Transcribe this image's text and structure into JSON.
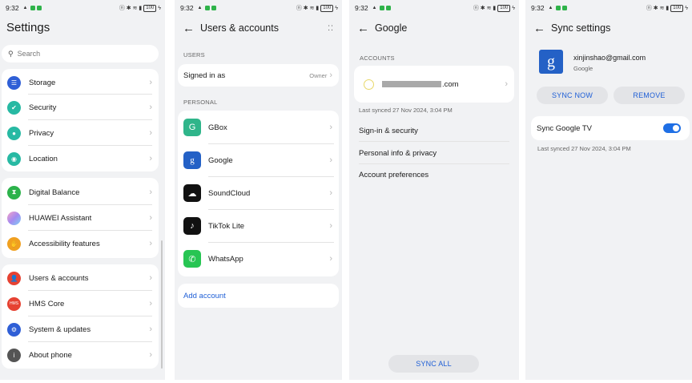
{
  "status": {
    "time": "9:32",
    "battery": "100"
  },
  "settings": {
    "title": "Settings",
    "search_placeholder": "Search",
    "group1": [
      {
        "label": "Storage",
        "icon": "storage-icon",
        "color": "#2f5fd6"
      },
      {
        "label": "Security",
        "icon": "shield-icon",
        "color": "#27b9a3"
      },
      {
        "label": "Privacy",
        "icon": "privacy-icon",
        "color": "#27b9a3"
      },
      {
        "label": "Location",
        "icon": "location-icon",
        "color": "#27b9a3"
      }
    ],
    "group2": [
      {
        "label": "Digital Balance",
        "icon": "hourglass-icon",
        "color": "#2cb24b"
      },
      {
        "label": "HUAWEI Assistant",
        "icon": "assistant-icon",
        "color": "#e08ad0"
      },
      {
        "label": "Accessibility features",
        "icon": "hand-icon",
        "color": "#f0a020"
      }
    ],
    "group3": [
      {
        "label": "Users & accounts",
        "icon": "user-icon",
        "color": "#e64232"
      },
      {
        "label": "HMS Core",
        "icon": "hms-icon",
        "color": "#e64232",
        "text": "HMS"
      },
      {
        "label": "System & updates",
        "icon": "system-icon",
        "color": "#2f5fd6"
      },
      {
        "label": "About phone",
        "icon": "info-icon",
        "color": "#555555"
      }
    ]
  },
  "users": {
    "title": "Users & accounts",
    "users_label": "USERS",
    "signed_in_as": "Signed in as",
    "owner": "Owner",
    "personal_label": "PERSONAL",
    "apps": [
      {
        "label": "GBox",
        "icon": "gbox-icon",
        "color": "#2fb58a"
      },
      {
        "label": "Google",
        "icon": "google-icon",
        "color": "#2461c6",
        "glyph": "g"
      },
      {
        "label": "SoundCloud",
        "icon": "soundcloud-icon",
        "color": "#111111"
      },
      {
        "label": "TikTok Lite",
        "icon": "tiktok-icon",
        "color": "#111111"
      },
      {
        "label": "WhatsApp",
        "icon": "whatsapp-icon",
        "color": "#27c553"
      }
    ],
    "add_account": "Add account"
  },
  "google": {
    "title": "Google",
    "accounts_label": "ACCOUNTS",
    "account_suffix": ".com",
    "last_synced": "Last synced 27 Nov 2024, 3:04 PM",
    "rows": [
      "Sign-in & security",
      "Personal info & privacy",
      "Account preferences"
    ],
    "sync_all": "SYNC ALL"
  },
  "sync": {
    "title": "Sync settings",
    "email": "xinjinshao@gmail.com",
    "provider": "Google",
    "sync_now": "SYNC NOW",
    "remove": "REMOVE",
    "item": "Sync Google TV",
    "item_enabled": true,
    "last_synced": "Last synced 27 Nov 2024, 3:04 PM"
  }
}
